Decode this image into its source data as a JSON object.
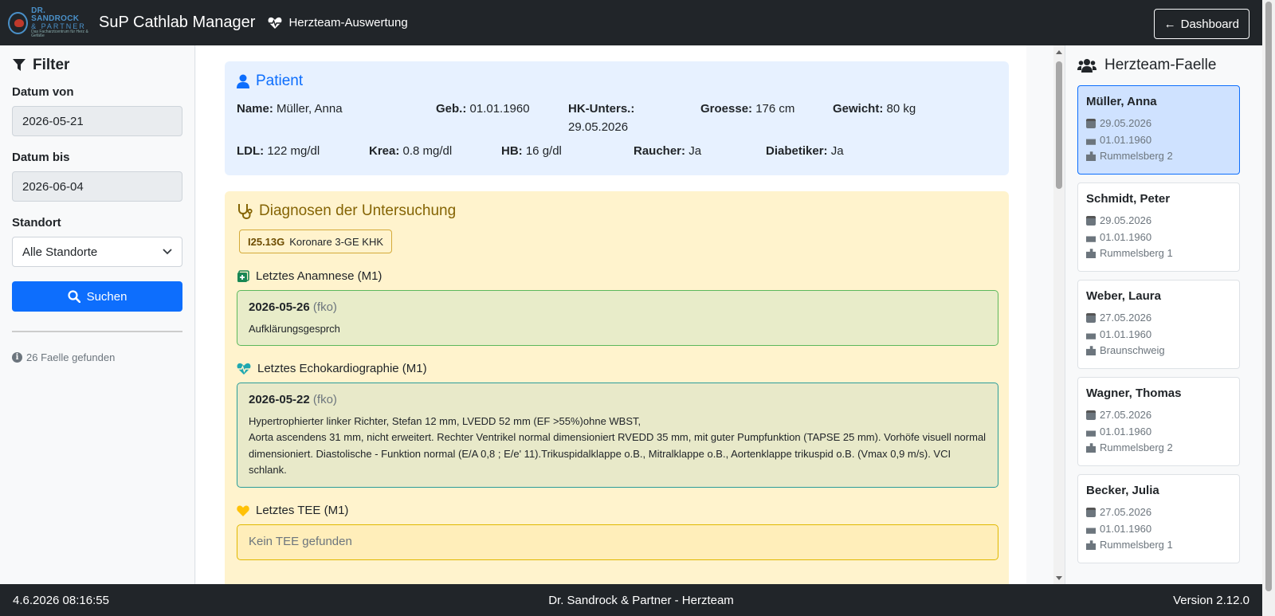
{
  "navbar": {
    "logo_line1": "DR. SANDROCK",
    "logo_line2": "& PARTNER",
    "logo_line3": "Das Facharztcentrum für Herz & Gefäße",
    "app_title": "SuP Cathlab Manager",
    "section": "Herzteam-Auswertung",
    "dashboard_label": "Dashboard"
  },
  "filter": {
    "title": "Filter",
    "date_from_label": "Datum von",
    "date_from_value": "2026-05-21",
    "date_to_label": "Datum bis",
    "date_to_value": "2026-06-04",
    "location_label": "Standort",
    "location_value": "Alle Standorte",
    "search_label": "Suchen",
    "result_count": "26 Faelle gefunden"
  },
  "patient": {
    "title": "Patient",
    "name_label": "Name:",
    "name": "Müller, Anna",
    "dob_label": "Geb.:",
    "dob": "01.01.1960",
    "hk_label": "HK-Unters.:",
    "hk": "29.05.2026",
    "height_label": "Groesse:",
    "height": "176 cm",
    "weight_label": "Gewicht:",
    "weight": "80 kg",
    "ldl_label": "LDL:",
    "ldl": "122 mg/dl",
    "krea_label": "Krea:",
    "krea": "0.8 mg/dl",
    "hb_label": "HB:",
    "hb": "16 g/dl",
    "smoker_label": "Raucher:",
    "smoker": "Ja",
    "diabetic_label": "Diabetiker:",
    "diabetic": "Ja"
  },
  "diagnoses": {
    "title": "Diagnosen der Untersuchung",
    "badge_code": "I25.13G",
    "badge_text": "Koronare 3-GE KHK",
    "anamnese": {
      "heading": "Letztes Anamnese (M1)",
      "date": "2026-05-26",
      "user": "(fko)",
      "text": "Aufklärungsgesprch"
    },
    "echo": {
      "heading": "Letztes Echokardiographie (M1)",
      "date": "2026-05-22",
      "user": "(fko)",
      "text_line1": "Hypertrophierter linker Richter, Stefan 12 mm, LVEDD 52 mm (EF >55%)ohne WBST,",
      "text_line2": "Aorta ascendens 31 mm, nicht erweitert. Rechter Ventrikel normal dimensioniert RVEDD 35 mm, mit guter Pumpfunktion (TAPSE 25 mm). Vorhöfe visuell normal dimensioniert. Diastolische - Funktion normal (E/A 0,8 ; E/e' 11).Trikuspidalklappe o.B., Mitralklappe o.B., Aortenklappe trikuspid o.B. (Vmax 0,9 m/s). VCI schlank."
    },
    "tee": {
      "heading": "Letztes TEE (M1)",
      "empty": "Kein TEE gefunden"
    }
  },
  "cases": {
    "title": "Herzteam-Faelle",
    "items": [
      {
        "name": "Müller, Anna",
        "date": "29.05.2026",
        "dob": "01.01.1960",
        "location": "Rummelsberg 2"
      },
      {
        "name": "Schmidt, Peter",
        "date": "29.05.2026",
        "dob": "01.01.1960",
        "location": "Rummelsberg 1"
      },
      {
        "name": "Weber, Laura",
        "date": "27.05.2026",
        "dob": "01.01.1960",
        "location": "Braunschweig"
      },
      {
        "name": "Wagner, Thomas",
        "date": "27.05.2026",
        "dob": "01.01.1960",
        "location": "Rummelsberg 2"
      },
      {
        "name": "Becker, Julia",
        "date": "27.05.2026",
        "dob": "01.01.1960",
        "location": "Rummelsberg 1"
      }
    ]
  },
  "footer": {
    "timestamp": "4.6.2026 08:16:55",
    "center": "Dr. Sandrock & Partner - Herzteam",
    "version": "Version 2.12.0"
  },
  "colors": {
    "navbar": "#212529",
    "primary": "#0d6efd",
    "patient_bg": "#e7f1ff",
    "diag_bg": "#fff3cd",
    "active_case_bg": "#cfe2ff"
  }
}
